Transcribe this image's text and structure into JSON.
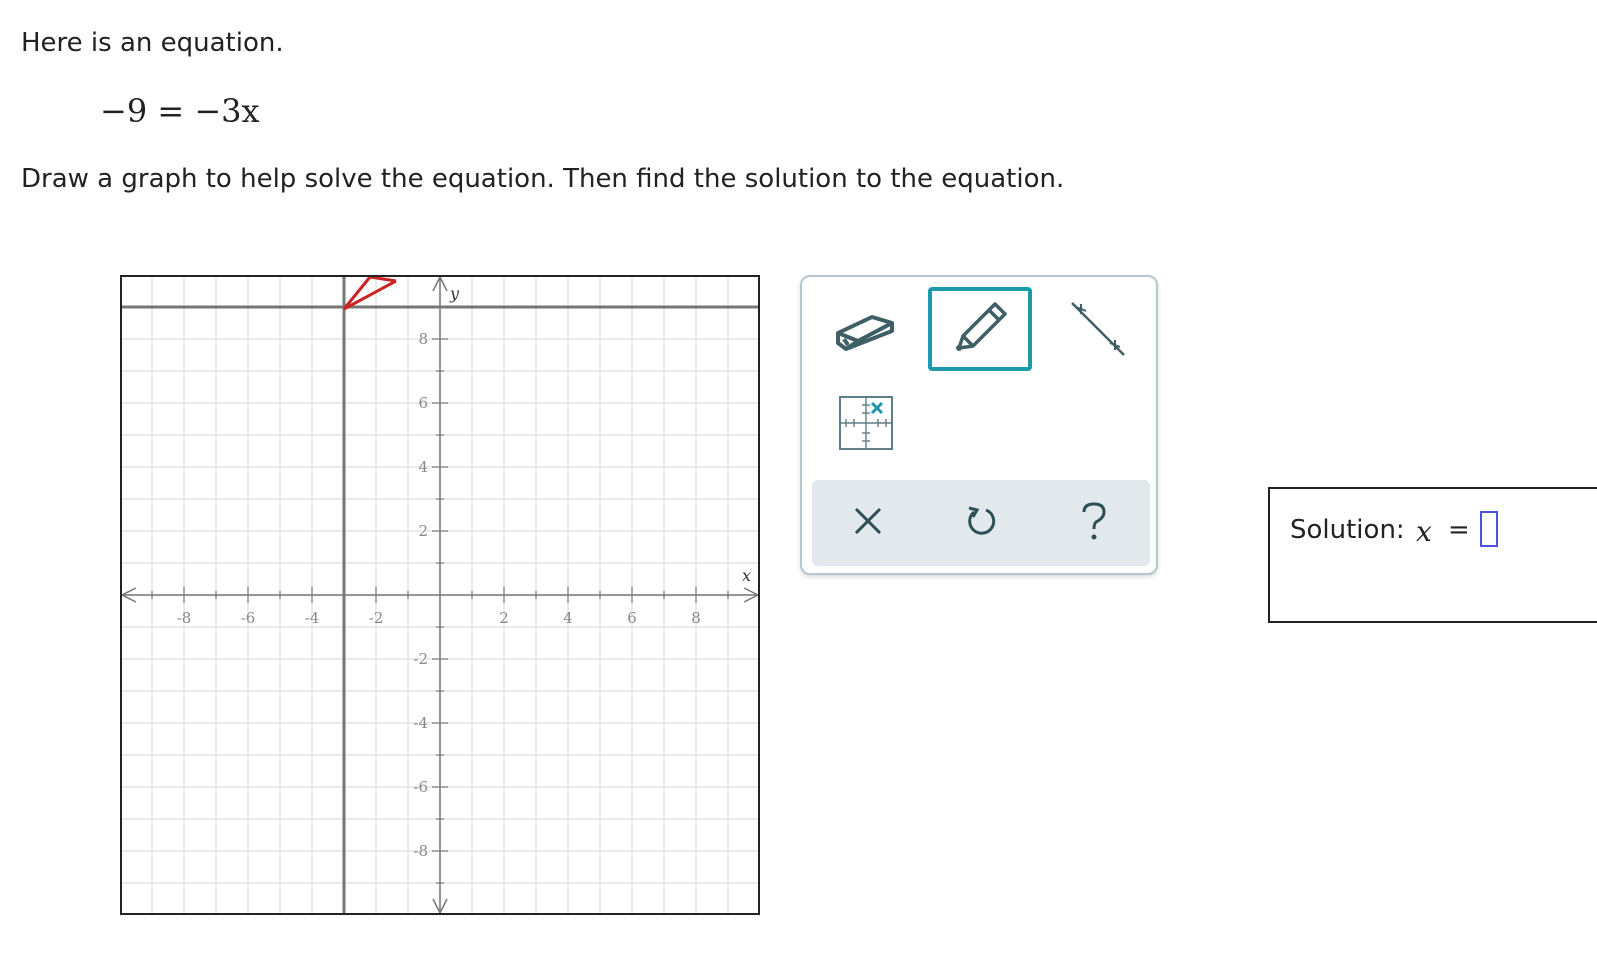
{
  "problem": {
    "intro": "Here is an equation.",
    "equation": "−9 = −3x",
    "instruction": "Draw a graph to help solve the equation. Then find the solution to the equation."
  },
  "graph": {
    "x_label": "x",
    "y_label": "y",
    "x_range": [
      -10,
      10
    ],
    "y_range": [
      -10,
      10
    ],
    "x_tick_labels": [
      "-8",
      "-6",
      "-4",
      "-2",
      "2",
      "4",
      "6",
      "8"
    ],
    "y_tick_labels": [
      "8",
      "6",
      "4",
      "2",
      "-2",
      "-4",
      "-6",
      "-8"
    ],
    "drawn_lines": [
      {
        "orientation": "vertical",
        "x": -3
      },
      {
        "orientation": "horizontal",
        "y": 9
      }
    ],
    "line_color": "#777777",
    "pencil_mark_color": "#cc2222"
  },
  "toolbox": {
    "tools": [
      "eraser-icon",
      "pencil-icon",
      "line-icon",
      "point-icon"
    ],
    "selected_tool": "pencil",
    "accent_color": "#1a9aab",
    "actions": [
      "clear-icon",
      "undo-icon",
      "help-icon"
    ]
  },
  "solution": {
    "label": "Solution:",
    "variable": "x",
    "equals": "=",
    "value": "",
    "input_border_color": "#4b52e0"
  }
}
